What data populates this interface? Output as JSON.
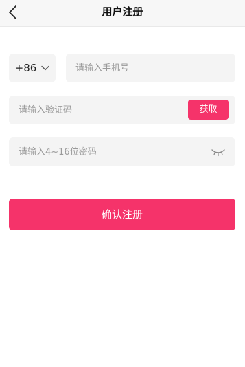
{
  "header": {
    "title": "用户注册",
    "back_icon": "chevron-left-icon"
  },
  "form": {
    "country_code": "+86",
    "country_code_icon": "chevron-down-icon",
    "phone_placeholder": "请输入手机号",
    "code_placeholder": "请输入验证码",
    "get_code_label": "获取",
    "password_placeholder": "请输入4~16位密码",
    "password_toggle_icon": "eye-closed-icon",
    "submit_label": "确认注册"
  },
  "colors": {
    "accent": "#f5336a",
    "field_background": "#f4f4f4",
    "nav_background": "#f7f7f7"
  }
}
